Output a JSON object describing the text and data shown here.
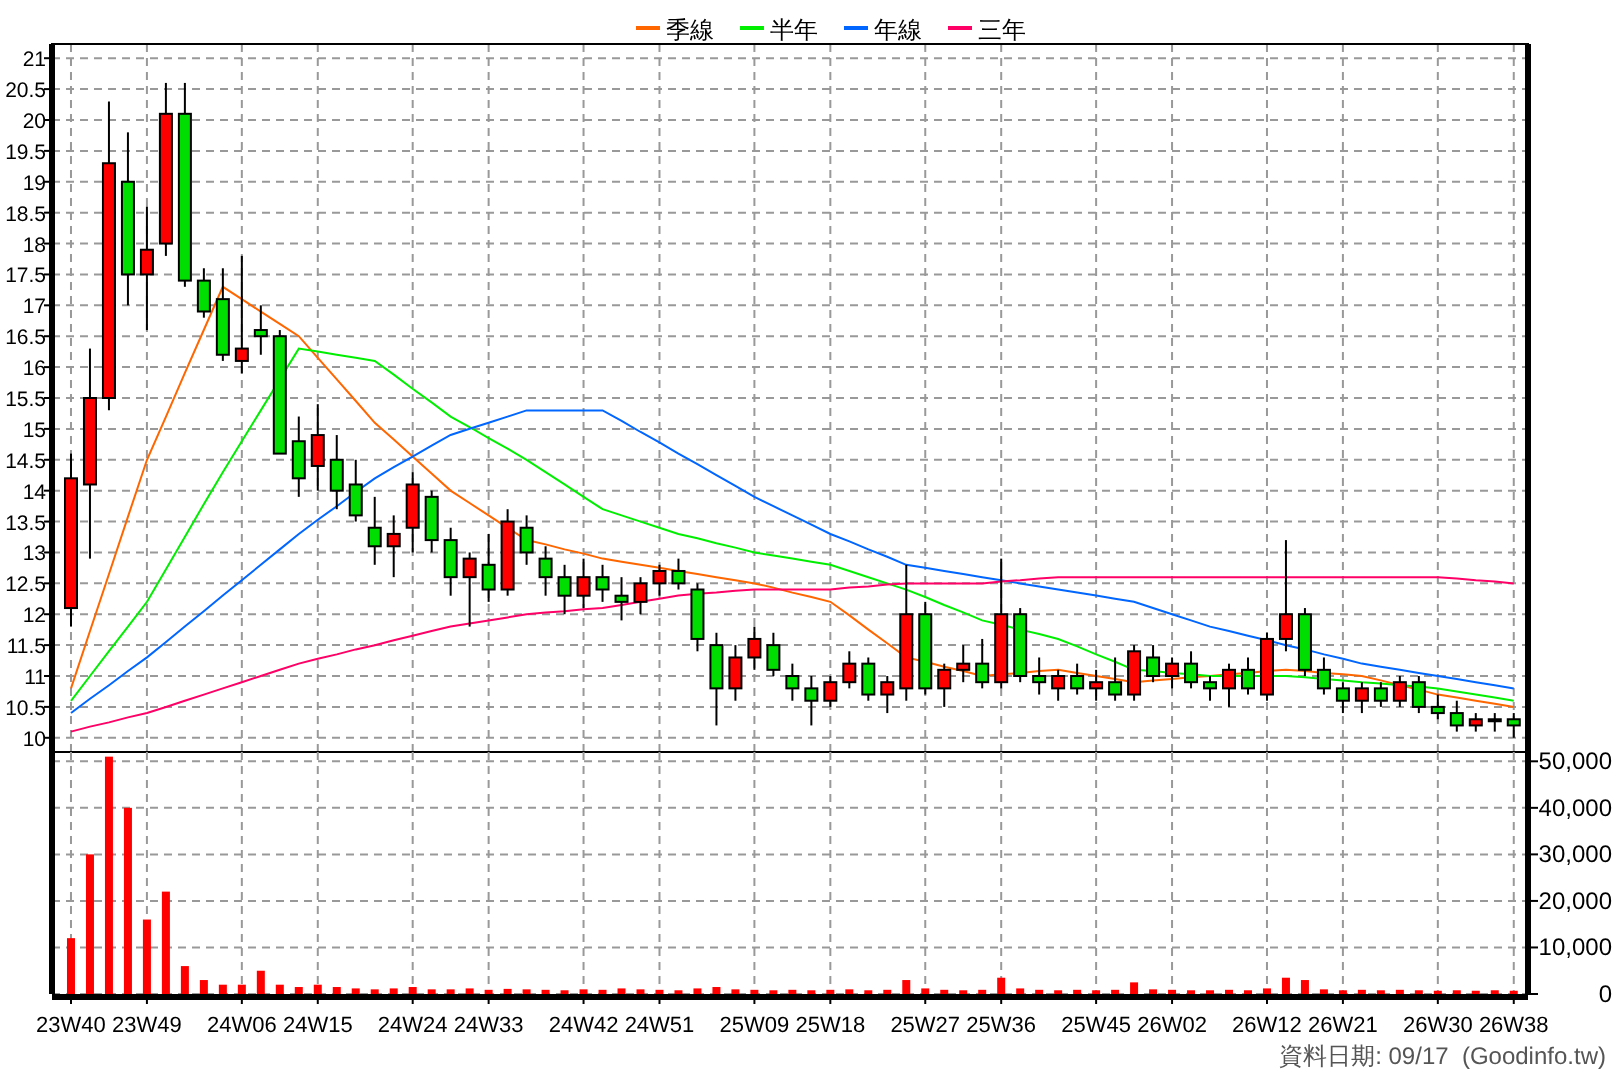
{
  "price_chart": {
    "chart_data": {
      "type": "candlestick",
      "ylim": [
        9.77,
        21.23
      ],
      "grid": true,
      "categories": [
        null,
        null,
        null,
        null,
        null,
        null,
        null,
        null,
        null,
        null,
        null,
        null,
        null,
        null,
        null,
        null,
        null,
        null,
        null,
        null,
        null,
        null,
        null,
        null,
        null,
        null,
        null,
        null,
        null,
        null,
        null,
        null,
        null,
        null,
        null,
        null,
        null,
        null,
        null,
        null,
        null,
        null,
        null,
        null,
        null,
        null,
        null,
        null,
        null,
        null,
        null,
        null,
        null,
        null,
        null,
        null,
        null,
        null,
        null,
        null,
        null,
        null,
        null,
        null,
        null,
        null,
        null,
        null,
        null,
        null,
        null,
        null,
        null,
        null,
        null,
        null,
        null
      ],
      "series": [
        {
          "name": "季線",
          "type": "line",
          "color": "#ff6600",
          "values": [
            10.8,
            11.73,
            12.65,
            13.58,
            14.5,
            15.2,
            15.9,
            16.6,
            17.3,
            17.1,
            16.9,
            16.7,
            16.5,
            16.15,
            15.8,
            15.45,
            15.1,
            14.83,
            14.55,
            14.28,
            14.0,
            13.8,
            13.6,
            13.4,
            13.2,
            13.13,
            13.05,
            12.98,
            12.9,
            12.85,
            12.8,
            12.75,
            12.7,
            12.65,
            12.6,
            12.55,
            12.5,
            12.43,
            12.35,
            12.28,
            12.2,
            11.98,
            11.75,
            11.53,
            11.3,
            11.23,
            11.15,
            11.08,
            11.0,
            11.03,
            11.05,
            11.08,
            11.1,
            11.05,
            11.0,
            10.95,
            10.9,
            10.93,
            10.95,
            10.98,
            11.0,
            11.03,
            11.05,
            11.08,
            11.1,
            11.08,
            11.05,
            11.03,
            11.0,
            10.93,
            10.85,
            10.78,
            10.7,
            10.65,
            10.6,
            10.55,
            10.5
          ]
        },
        {
          "name": "半年",
          "type": "line",
          "color": "#00ee00",
          "values": [
            10.6,
            11.0,
            11.4,
            11.8,
            12.2,
            12.73,
            13.25,
            13.78,
            14.3,
            14.8,
            15.3,
            15.8,
            16.3,
            16.25,
            16.2,
            16.15,
            16.1,
            15.88,
            15.65,
            15.43,
            15.2,
            15.03,
            14.85,
            14.68,
            14.5,
            14.3,
            14.1,
            13.9,
            13.7,
            13.6,
            13.5,
            13.4,
            13.3,
            13.23,
            13.15,
            13.08,
            13.0,
            12.95,
            12.9,
            12.85,
            12.8,
            12.7,
            12.6,
            12.5,
            12.4,
            12.28,
            12.15,
            12.03,
            11.9,
            11.83,
            11.75,
            11.68,
            11.6,
            11.48,
            11.35,
            11.23,
            11.1,
            11.08,
            11.05,
            11.03,
            11.0,
            11.0,
            11.0,
            11.0,
            11.0,
            10.98,
            10.95,
            10.93,
            10.9,
            10.88,
            10.85,
            10.83,
            10.8,
            10.75,
            10.7,
            10.65,
            10.6
          ]
        },
        {
          "name": "年線",
          "type": "line",
          "color": "#0066ff",
          "values": [
            10.4,
            10.63,
            10.85,
            11.08,
            11.3,
            11.55,
            11.8,
            12.05,
            12.3,
            12.55,
            12.8,
            13.05,
            13.3,
            13.53,
            13.75,
            13.98,
            14.2,
            14.38,
            14.55,
            14.73,
            14.9,
            15.0,
            15.1,
            15.2,
            15.3,
            15.3,
            15.3,
            15.3,
            15.3,
            15.13,
            14.95,
            14.78,
            14.6,
            14.43,
            14.25,
            14.08,
            13.9,
            13.75,
            13.6,
            13.45,
            13.3,
            13.18,
            13.05,
            12.93,
            12.8,
            12.75,
            12.7,
            12.65,
            12.6,
            12.55,
            12.5,
            12.45,
            12.4,
            12.35,
            12.3,
            12.25,
            12.2,
            12.1,
            12.0,
            11.9,
            11.8,
            11.73,
            11.65,
            11.58,
            11.5,
            11.43,
            11.35,
            11.28,
            11.2,
            11.15,
            11.1,
            11.05,
            11.0,
            10.95,
            10.9,
            10.85,
            10.8
          ]
        },
        {
          "name": "三年",
          "type": "line",
          "color": "#ff0066",
          "values": [
            10.1,
            10.18,
            10.25,
            10.33,
            10.4,
            10.5,
            10.6,
            10.7,
            10.8,
            10.9,
            11.0,
            11.1,
            11.2,
            11.28,
            11.35,
            11.43,
            11.5,
            11.58,
            11.65,
            11.73,
            11.8,
            11.85,
            11.9,
            11.95,
            12.0,
            12.03,
            12.05,
            12.08,
            12.1,
            12.15,
            12.2,
            12.25,
            12.3,
            12.33,
            12.35,
            12.38,
            12.4,
            12.4,
            12.4,
            12.4,
            12.4,
            12.43,
            12.45,
            12.48,
            12.5,
            12.5,
            12.5,
            12.5,
            12.5,
            12.53,
            12.55,
            12.58,
            12.6,
            12.6,
            12.6,
            12.6,
            12.6,
            12.6,
            12.6,
            12.6,
            12.6,
            12.6,
            12.6,
            12.6,
            12.6,
            12.6,
            12.6,
            12.6,
            12.6,
            12.6,
            12.6,
            12.6,
            12.6,
            12.58,
            12.55,
            12.53,
            12.5
          ]
        }
      ],
      "yticks": [
        21,
        20.5,
        20,
        19.5,
        19,
        18.5,
        18,
        17.5,
        17,
        16.5,
        16,
        15.5,
        15,
        14.5,
        14,
        13.5,
        13,
        12.5,
        12,
        11.5,
        11,
        10.5,
        10
      ],
      "ohlc": [
        [
          12.1,
          14.6,
          11.8,
          14.2
        ],
        [
          14.1,
          16.3,
          12.9,
          15.5
        ],
        [
          15.5,
          20.3,
          15.3,
          19.3
        ],
        [
          19.0,
          19.8,
          17.0,
          17.5
        ],
        [
          17.5,
          18.6,
          16.6,
          17.9
        ],
        [
          18.0,
          20.6,
          17.8,
          20.1
        ],
        [
          20.1,
          20.6,
          17.3,
          17.4
        ],
        [
          17.4,
          17.6,
          16.8,
          16.9
        ],
        [
          17.1,
          17.6,
          16.1,
          16.2
        ],
        [
          16.1,
          17.8,
          15.9,
          16.3
        ],
        [
          16.6,
          17.0,
          16.2,
          16.5
        ],
        [
          16.5,
          16.6,
          14.6,
          14.6
        ],
        [
          14.8,
          15.2,
          13.9,
          14.2
        ],
        [
          14.4,
          15.4,
          14.0,
          14.9
        ],
        [
          14.5,
          14.9,
          13.7,
          14.0
        ],
        [
          14.1,
          14.5,
          13.5,
          13.6
        ],
        [
          13.4,
          13.9,
          12.8,
          13.1
        ],
        [
          13.1,
          13.6,
          12.6,
          13.3
        ],
        [
          13.4,
          14.3,
          13.0,
          14.1
        ],
        [
          13.9,
          14.0,
          13.0,
          13.2
        ],
        [
          13.2,
          13.4,
          12.3,
          12.6
        ],
        [
          12.6,
          13.0,
          11.8,
          12.9
        ],
        [
          12.8,
          13.3,
          12.2,
          12.4
        ],
        [
          12.4,
          13.7,
          12.3,
          13.5
        ],
        [
          13.4,
          13.6,
          12.8,
          13.0
        ],
        [
          12.9,
          13.1,
          12.3,
          12.6
        ],
        [
          12.6,
          12.8,
          12.0,
          12.3
        ],
        [
          12.3,
          12.9,
          12.1,
          12.6
        ],
        [
          12.6,
          12.8,
          12.2,
          12.4
        ],
        [
          12.3,
          12.6,
          11.9,
          12.2
        ],
        [
          12.2,
          12.6,
          12.0,
          12.5
        ],
        [
          12.5,
          12.8,
          12.3,
          12.7
        ],
        [
          12.7,
          12.9,
          12.4,
          12.5
        ],
        [
          12.4,
          12.5,
          11.4,
          11.6
        ],
        [
          11.5,
          11.7,
          10.2,
          10.8
        ],
        [
          10.8,
          11.5,
          10.6,
          11.3
        ],
        [
          11.3,
          11.8,
          11.1,
          11.6
        ],
        [
          11.5,
          11.7,
          11.0,
          11.1
        ],
        [
          11.0,
          11.2,
          10.6,
          10.8
        ],
        [
          10.8,
          11.0,
          10.2,
          10.6
        ],
        [
          10.6,
          11.0,
          10.5,
          10.9
        ],
        [
          10.9,
          11.4,
          10.8,
          11.2
        ],
        [
          11.2,
          11.3,
          10.6,
          10.7
        ],
        [
          10.7,
          11.0,
          10.4,
          10.9
        ],
        [
          10.8,
          12.8,
          10.6,
          12.0
        ],
        [
          12.0,
          12.2,
          10.7,
          10.8
        ],
        [
          10.8,
          11.2,
          10.5,
          11.1
        ],
        [
          11.1,
          11.5,
          10.9,
          11.2
        ],
        [
          11.2,
          11.6,
          10.8,
          10.9
        ],
        [
          10.9,
          12.9,
          10.8,
          12.0
        ],
        [
          12.0,
          12.1,
          10.9,
          11.0
        ],
        [
          11.0,
          11.3,
          10.7,
          10.9
        ],
        [
          10.8,
          11.1,
          10.6,
          11.0
        ],
        [
          11.0,
          11.2,
          10.7,
          10.8
        ],
        [
          10.8,
          11.1,
          10.6,
          10.9
        ],
        [
          10.9,
          11.3,
          10.6,
          10.7
        ],
        [
          10.7,
          11.5,
          10.6,
          11.4
        ],
        [
          11.3,
          11.5,
          10.9,
          11.0
        ],
        [
          11.0,
          11.3,
          10.8,
          11.2
        ],
        [
          11.2,
          11.4,
          10.8,
          10.9
        ],
        [
          10.9,
          11.0,
          10.6,
          10.8
        ],
        [
          10.8,
          11.2,
          10.5,
          11.1
        ],
        [
          11.1,
          11.3,
          10.7,
          10.8
        ],
        [
          10.7,
          11.7,
          10.6,
          11.6
        ],
        [
          11.6,
          13.2,
          11.4,
          12.0
        ],
        [
          12.0,
          12.1,
          11.0,
          11.1
        ],
        [
          11.1,
          11.3,
          10.7,
          10.8
        ],
        [
          10.8,
          10.9,
          10.4,
          10.6
        ],
        [
          10.6,
          10.9,
          10.4,
          10.8
        ],
        [
          10.8,
          10.9,
          10.5,
          10.6
        ],
        [
          10.6,
          11.0,
          10.5,
          10.9
        ],
        [
          10.9,
          11.0,
          10.4,
          10.5
        ],
        [
          10.5,
          10.7,
          10.3,
          10.4
        ],
        [
          10.4,
          10.6,
          10.1,
          10.2
        ],
        [
          10.2,
          10.4,
          10.1,
          10.3
        ],
        [
          10.3,
          10.4,
          10.1,
          10.3
        ],
        [
          10.3,
          10.4,
          10.0,
          10.2
        ]
      ]
    }
  },
  "volume_chart": {
    "chart_data": {
      "type": "bar",
      "ylim": [
        0,
        52000
      ],
      "grid": true,
      "color": "#ff0000",
      "categories": [
        "23W40",
        null,
        null,
        null,
        "23W49",
        null,
        null,
        null,
        null,
        "24W06",
        null,
        null,
        null,
        "24W15",
        null,
        null,
        null,
        null,
        "24W24",
        null,
        null,
        null,
        "24W33",
        null,
        null,
        null,
        null,
        "24W42",
        null,
        null,
        null,
        "24W51",
        null,
        null,
        null,
        null,
        "25W09",
        null,
        null,
        null,
        "25W18",
        null,
        null,
        null,
        null,
        "25W27",
        null,
        null,
        null,
        "25W36",
        null,
        null,
        null,
        null,
        "25W45",
        null,
        null,
        null,
        "26W02",
        null,
        null,
        null,
        null,
        "26W12",
        null,
        null,
        null,
        "26W21",
        null,
        null,
        null,
        null,
        "26W30",
        null,
        null,
        null,
        "26W38"
      ],
      "values": [
        12000,
        30000,
        51000,
        40000,
        16000,
        22000,
        6000,
        3000,
        2000,
        2000,
        5000,
        2000,
        1500,
        2000,
        1500,
        1200,
        1000,
        1200,
        1500,
        1000,
        1000,
        1200,
        900,
        1100,
        1000,
        900,
        800,
        1000,
        900,
        1200,
        1000,
        900,
        800,
        1200,
        1500,
        1000,
        900,
        800,
        900,
        800,
        900,
        1000,
        800,
        900,
        3000,
        1200,
        900,
        800,
        900,
        3500,
        1200,
        900,
        800,
        900,
        800,
        900,
        2500,
        1000,
        900,
        800,
        800,
        900,
        800,
        1200,
        3500,
        3000,
        1000,
        800,
        900,
        800,
        900,
        800,
        700,
        800,
        700,
        800,
        700
      ],
      "yticks": [
        {
          "value": 50000,
          "label": "50,000"
        },
        {
          "value": 40000,
          "label": "40,000"
        },
        {
          "value": 30000,
          "label": "30,000"
        },
        {
          "value": 20000,
          "label": "20,000"
        },
        {
          "value": 10000,
          "label": "10,000"
        },
        {
          "value": 0,
          "label": "0"
        }
      ]
    }
  },
  "footer": "資料日期: 09/17  (Goodinfo.tw)"
}
